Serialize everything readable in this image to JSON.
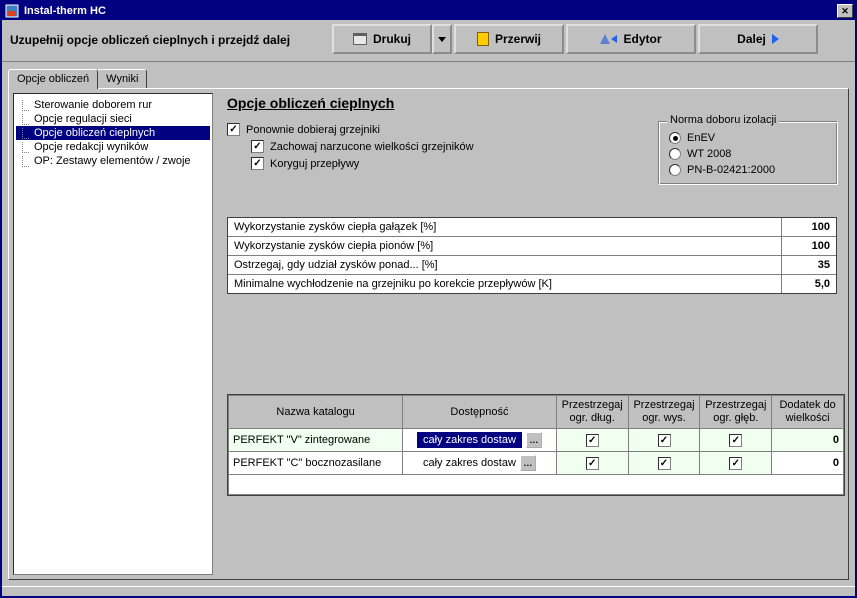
{
  "window": {
    "title": "Instal-therm HC"
  },
  "header": {
    "instruction": "Uzupełnij opcje obliczeń cieplnych i przejdź dalej",
    "buttons": {
      "print": "Drukuj",
      "interrupt": "Przerwij",
      "editor": "Edytor",
      "next": "Dalej"
    }
  },
  "tabs": {
    "options": "Opcje obliczeń",
    "results": "Wyniki"
  },
  "tree": {
    "items": [
      "Sterowanie doborem rur",
      "Opcje regulacji sieci",
      "Opcje obliczeń cieplnych",
      "Opcje redakcji wyników",
      "OP: Zestawy elementów / zwoje"
    ],
    "selected_index": 2
  },
  "panel": {
    "title": "Opcje obliczeń cieplnych",
    "checks": {
      "redo_radiators": "Ponownie dobieraj grzejniki",
      "keep_forced": "Zachowaj narzucone wielkości grzejników",
      "correct_flows": "Koryguj przepływy"
    },
    "norma_box": {
      "legend": "Norma doboru izolacji",
      "opt1": "EnEV",
      "opt2": "WT 2008",
      "opt3": "PN-B-02421:2000"
    },
    "params": [
      {
        "label": "Wykorzystanie zysków ciepła gałązek [%]",
        "value": "100"
      },
      {
        "label": "Wykorzystanie zysków ciepła pionów [%]",
        "value": "100"
      },
      {
        "label": "Ostrzegaj, gdy udział zysków ponad... [%]",
        "value": "35"
      },
      {
        "label": "Minimalne wychłodzenie na grzejniku po korekcie przepływów [K]",
        "value": "5,0"
      }
    ],
    "catalog": {
      "headers": {
        "name": "Nazwa katalogu",
        "avail": "Dostępność",
        "lim_len": "Przestrzegaj ogr. dług.",
        "lim_h": "Przestrzegaj ogr. wys.",
        "lim_d": "Przestrzegaj ogr. głęb.",
        "addon": "Dodatek do wielkości"
      },
      "rows": [
        {
          "name": "PERFEKT \"V\" zintegrowane",
          "avail": "cały zakres dostaw",
          "lim_len": true,
          "lim_h": true,
          "lim_d": true,
          "addon": "0",
          "active": true
        },
        {
          "name": "PERFEKT \"C\" bocznozasilane",
          "avail": "cały zakres dostaw",
          "lim_len": true,
          "lim_h": true,
          "lim_d": true,
          "addon": "0",
          "active": false
        }
      ]
    }
  }
}
